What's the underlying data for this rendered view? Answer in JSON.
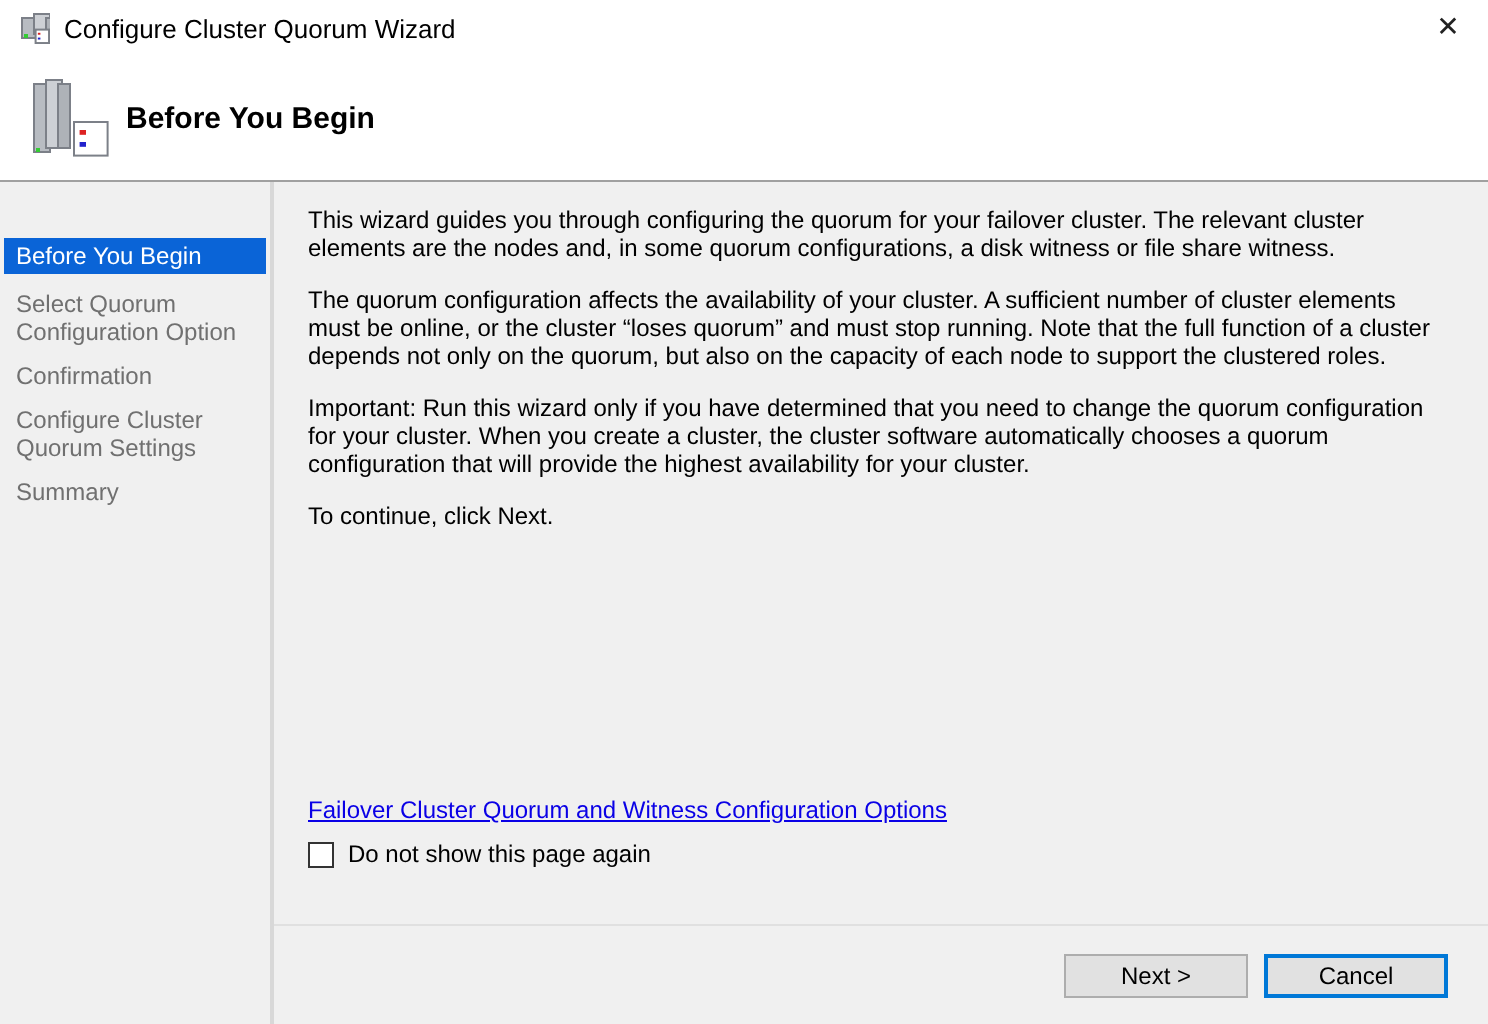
{
  "window": {
    "title": "Configure Cluster Quorum Wizard",
    "close": "✕"
  },
  "header": {
    "title": "Before You Begin"
  },
  "sidebar": {
    "items": [
      {
        "label": "Before You Begin",
        "selected": true
      },
      {
        "label": "Select Quorum Configuration Option",
        "selected": false
      },
      {
        "label": "Confirmation",
        "selected": false
      },
      {
        "label": "Configure Cluster Quorum Settings",
        "selected": false
      },
      {
        "label": "Summary",
        "selected": false
      }
    ]
  },
  "content": {
    "paragraphs": [
      "This wizard guides you through configuring the quorum for your failover cluster. The relevant cluster elements are the nodes and, in some quorum configurations, a disk witness or file share witness.",
      "The quorum configuration affects the availability of your cluster. A sufficient number of cluster elements must be online, or the cluster “loses quorum” and must stop running. Note that the full function of a cluster depends not only on the quorum, but also on the capacity of each node to support the clustered roles.",
      "Important: Run this wizard only if you have determined that you need to change the quorum configuration for your cluster. When you create a cluster, the cluster software automatically chooses a quorum configuration that will provide the highest availability for your cluster.",
      "To continue, click Next."
    ],
    "link": "Failover Cluster Quorum and Witness Configuration Options",
    "checkbox": {
      "label": "Do not show this page again",
      "checked": false
    }
  },
  "buttons": [
    {
      "label": "Next >",
      "default": false
    },
    {
      "label": "Cancel",
      "default": true
    }
  ]
}
